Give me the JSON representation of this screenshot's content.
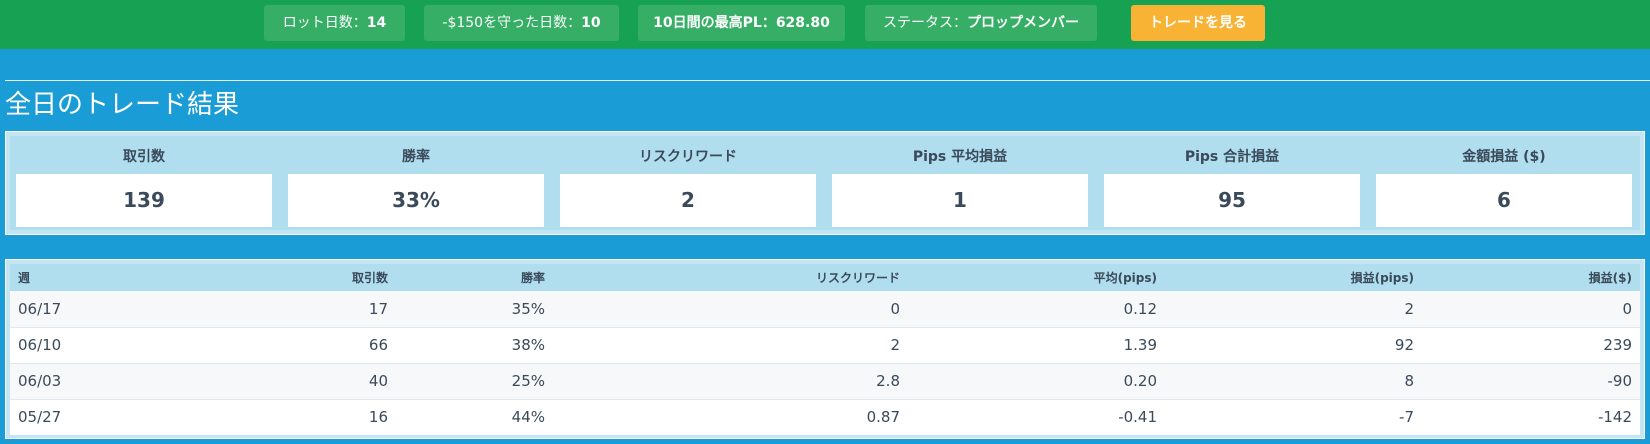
{
  "topbar": {
    "chips": [
      {
        "label": "ロット日数：",
        "value": "14"
      },
      {
        "label": "-$150を守った日数：",
        "value": "10"
      },
      {
        "label": "10日間の最高PL：",
        "value": "628.80"
      },
      {
        "label": "ステータス：",
        "value": "プロップメンバー"
      }
    ],
    "button_label": "トレードを見る"
  },
  "section_title": "全日のトレード結果",
  "summary": [
    {
      "label": "取引数",
      "value": "139"
    },
    {
      "label": "勝率",
      "value": "33%"
    },
    {
      "label": "リスクリワード",
      "value": "2"
    },
    {
      "label": "Pips 平均損益",
      "value": "1"
    },
    {
      "label": "Pips 合計損益",
      "value": "95"
    },
    {
      "label": "金額損益 ($)",
      "value": "6"
    }
  ],
  "table": {
    "columns": [
      "週",
      "取引数",
      "勝率",
      "リスクリワード",
      "平均(pips)",
      "損益(pips)",
      "損益($)"
    ],
    "rows": [
      [
        "06/17",
        "17",
        "35%",
        "0",
        "0.12",
        "2",
        "0"
      ],
      [
        "06/10",
        "66",
        "38%",
        "2",
        "1.39",
        "92",
        "239"
      ],
      [
        "06/03",
        "40",
        "25%",
        "2.8",
        "0.20",
        "8",
        "-90"
      ],
      [
        "05/27",
        "16",
        "44%",
        "0.87",
        "-0.41",
        "-7",
        "-142"
      ]
    ]
  },
  "colors": {
    "topbar": "#17a253",
    "chip": "#36ae66",
    "button": "#f8b234",
    "background": "#1a9cd6",
    "panel": "#b0deef"
  }
}
